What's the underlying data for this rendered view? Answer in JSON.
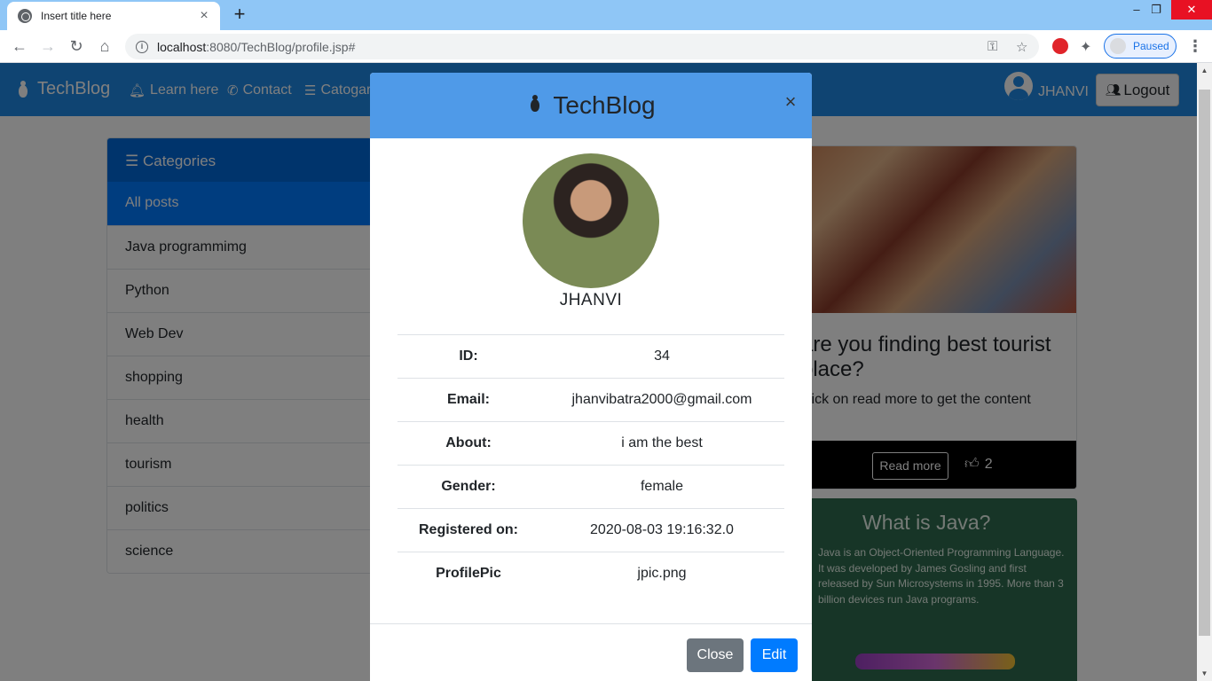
{
  "browser": {
    "tab_title": "Insert title here",
    "tab_close": "×",
    "new_tab": "+",
    "url_host": "localhost",
    "url_rest": ":8080/TechBlog/profile.jsp#",
    "paused_label": "Paused",
    "window_controls": [
      "–",
      "❐",
      "✕"
    ]
  },
  "navbar": {
    "brand": "TechBlog",
    "links": [
      "Learn here",
      "Contact",
      "Catogar"
    ],
    "user_name": "JHANVI",
    "logout": "Logout"
  },
  "sidebar": {
    "header": "Categories",
    "items": [
      "All posts",
      "Java programmimg",
      "Python",
      "Web Dev",
      "shopping",
      "health",
      "tourism",
      "politics",
      "science"
    ]
  },
  "post1": {
    "title": "are you finding best tourist place?",
    "text": "click on read more to get the content",
    "read_more": "Read more",
    "likes": "2"
  },
  "post2": {
    "title": "What is Java?",
    "body": "Java is an Object-Oriented Programming Language. It was developed by James Gosling and first released by Sun Microsystems in 1995. More than 3 billion devices run Java programs."
  },
  "modal": {
    "title": "TechBlog",
    "close_x": "×",
    "name": "JHANVI",
    "rows": [
      {
        "label": "ID:",
        "value": "34"
      },
      {
        "label": "Email:",
        "value": "jhanvibatra2000@gmail.com"
      },
      {
        "label": "About:",
        "value": "i am the best"
      },
      {
        "label": "Gender:",
        "value": "female"
      },
      {
        "label": "Registered on:",
        "value": "2020-08-03 19:16:32.0"
      },
      {
        "label": "ProfilePic",
        "value": "jpic.png"
      }
    ],
    "close_button": "Close",
    "edit_button": "Edit"
  },
  "colors": {
    "navbar": "#1e88e5",
    "modal_header": "#4f9ae8",
    "primary": "#007bff",
    "secondary": "#6c757d"
  }
}
